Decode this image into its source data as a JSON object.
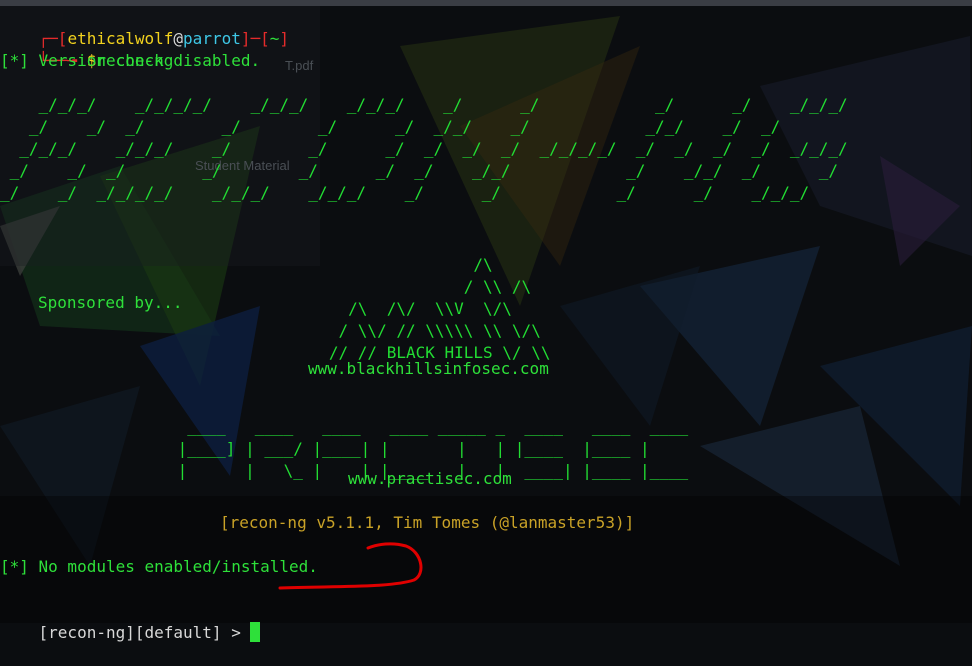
{
  "prompt": {
    "bracket_open": "┌─[",
    "user": "ethicalwolf",
    "at": "@",
    "host": "parrot",
    "sep": "]─[",
    "dir": "~",
    "bracket_close": "]",
    "line2_prefix": "└──╼ ",
    "dollar": "$",
    "command": "recon-ng"
  },
  "output": {
    "version_check": "[*] Version check disabled.",
    "sponsored": "Sponsored by...",
    "banner": "[recon-ng v5.1.1, Tim Tomes (@lanmaster53)]",
    "no_modules": "[*] No modules enabled/installed."
  },
  "ascii": {
    "logo": "    _/_/_/    _/_/_/_/    _/_/_/    _/_/_/    _/      _/            _/      _/    _/_/_/\n   _/    _/  _/        _/        _/      _/  _/_/    _/            _/_/    _/  _/\n  _/_/_/    _/_/_/    _/        _/      _/  _/  _/  _/  _/_/_/_/  _/  _/  _/  _/  _/_/_/\n _/    _/  _/        _/        _/      _/  _/    _/_/            _/    _/_/  _/      _/\n_/    _/  _/_/_/_/    _/_/_/    _/_/_/    _/      _/            _/      _/    _/_/_/",
    "blackhills": "                  /\\\n                 / \\\\ /\\\n     /\\  /\\/  \\\\V  \\/\\\n    / \\\\/ // \\\\\\\\\\ \\\\ \\/\\\n   // // BLACK HILLS \\/ \\\\",
    "blackhills_url": "www.blackhillsinfosec.com",
    "practisec": "  ____   ____   ____   ____ _____ _  ____   ____  ____\n |____] | ___/ |____| |       |   | |____  |____ |\n |      |   \\_ |    | |____   |   |  ____| |____ |____",
    "practisec_url": "www.practisec.com"
  },
  "console_prompt": {
    "text": "[recon-ng][default] > "
  },
  "background_fragments": {
    "file_label": "T.pdf",
    "folder_label": "Student Material"
  },
  "colors": {
    "prompt_red": "#e52b2b",
    "user_yellow": "#f2d21e",
    "host_cyan": "#3ec7e6",
    "output_green": "#2ee03a",
    "banner_gold": "#c9a227",
    "annotation_red": "#e00000"
  }
}
